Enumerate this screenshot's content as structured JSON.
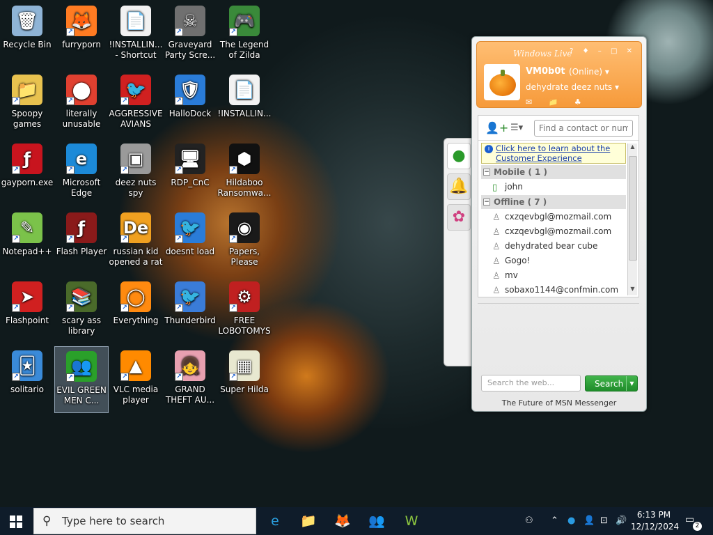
{
  "desktop": {
    "icons": [
      {
        "label": "Recycle Bin",
        "glyph": "🗑",
        "color": "#8fb4d6"
      },
      {
        "label": "furryporn",
        "glyph": "🦊",
        "color": "#ff7b22"
      },
      {
        "label": "!INSTALLIN... - Shortcut",
        "glyph": "📄",
        "color": "#f2f2f2"
      },
      {
        "label": "Graveyard Party Scre...",
        "glyph": "☠",
        "color": "#707070"
      },
      {
        "label": "The Legend of Zilda",
        "glyph": "🎮",
        "color": "#3a8a3a"
      },
      {
        "label": "Spoopy games",
        "glyph": "📁",
        "color": "#e8c24f"
      },
      {
        "label": "literally unusable",
        "glyph": "⬤",
        "color": "#e04030"
      },
      {
        "label": "AGGRESSIVE AVIANS",
        "glyph": "🐦",
        "color": "#d02020"
      },
      {
        "label": "HalloDock",
        "glyph": "🛡",
        "color": "#2a7cd8"
      },
      {
        "label": "!INSTALLIN...",
        "glyph": "📄",
        "color": "#f2f2f2"
      },
      {
        "label": "gayporn.exe",
        "glyph": "ƒ",
        "color": "#c8141e"
      },
      {
        "label": "Microsoft Edge",
        "glyph": "e",
        "color": "#1c8ad8"
      },
      {
        "label": "deez nuts spy",
        "glyph": "▣",
        "color": "#9a9a9a"
      },
      {
        "label": "RDP_CnC",
        "glyph": "🖥",
        "color": "#222222"
      },
      {
        "label": "Hildaboo Ransomwa...",
        "glyph": "⬢",
        "color": "#111111"
      },
      {
        "label": "Notepad++",
        "glyph": "✎",
        "color": "#7bc24a"
      },
      {
        "label": "Flash Player",
        "glyph": "ƒ",
        "color": "#8a1a1a"
      },
      {
        "label": "russian kid opened a rat",
        "glyph": "De",
        "color": "#f0a020"
      },
      {
        "label": "doesnt load",
        "glyph": "🐦",
        "color": "#2a7cd8"
      },
      {
        "label": "Papers, Please",
        "glyph": "◉",
        "color": "#1a1a1a"
      },
      {
        "label": "Flashpoint",
        "glyph": "➤",
        "color": "#d02020"
      },
      {
        "label": "scary ass library",
        "glyph": "📚",
        "color": "#4a6a2a"
      },
      {
        "label": "Everything",
        "glyph": "◯",
        "color": "#ff8a10"
      },
      {
        "label": "Thunderbird",
        "glyph": "🐦",
        "color": "#3a7cd8"
      },
      {
        "label": "FREE LOBOTOMYS",
        "glyph": "⚙",
        "color": "#c02020"
      },
      {
        "label": "solitario",
        "glyph": "🃏",
        "color": "#3a8ad8"
      },
      {
        "label": "EVIL GREEN MEN C...",
        "glyph": "👥",
        "color": "#2aa02a"
      },
      {
        "label": "VLC media player",
        "glyph": "▲",
        "color": "#ff8a00"
      },
      {
        "label": "GRAND THEFT AU...",
        "glyph": "👧",
        "color": "#e8a0b0"
      },
      {
        "label": "Super Hilda",
        "glyph": "▦",
        "color": "#e8e8d0"
      }
    ]
  },
  "msn": {
    "title": "Windows Live",
    "window_buttons": "? ♦ – □ ✕",
    "username": "VM0b0t",
    "status": "(Online) ▾",
    "personal_message": "dehydrate deez nuts ▾",
    "toolbar_icons": "✉ 📁 ♣",
    "find_placeholder": "Find a contact or number",
    "notice_text": "Click here to learn about the Customer Experience",
    "groups": [
      {
        "name": "Mobile ( 1 )",
        "contacts": [
          "john"
        ]
      },
      {
        "name": "Offline ( 7 )",
        "contacts": [
          "cxzqevbgl@mozmail.com",
          "cxzqevbgl@mozmail.com",
          "dehydrated bear cube",
          "Gogo!",
          "mv",
          "sobaxo1144@confmin.com"
        ]
      }
    ],
    "web_placeholder": "Search the web...",
    "search_label": "Search",
    "footer": "The Future of MSN Messenger"
  },
  "taskbar": {
    "search_placeholder": "Type here to search",
    "apps": [
      {
        "name": "edge",
        "glyph": "e",
        "color": "#2aa0e0"
      },
      {
        "name": "explorer",
        "glyph": "📁",
        "color": "#f0c040"
      },
      {
        "name": "firefox",
        "glyph": "🦊",
        "color": "#ff7b22"
      },
      {
        "name": "messenger",
        "glyph": "👥",
        "color": "#2aa02a"
      },
      {
        "name": "app-w",
        "glyph": "W",
        "color": "#8cc63f"
      }
    ],
    "time": "6:13 PM",
    "date": "12/12/2024",
    "notification_count": "2"
  }
}
